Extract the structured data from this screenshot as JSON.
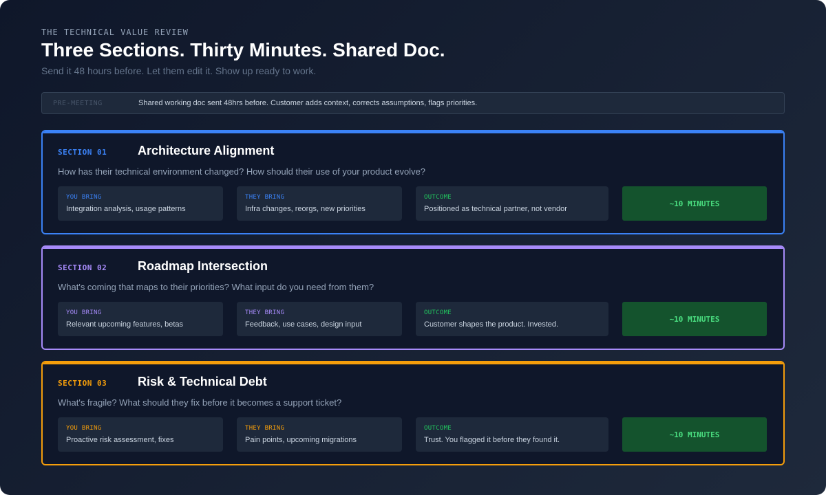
{
  "header": {
    "eyebrow": "THE TECHNICAL VALUE REVIEW",
    "title": "Three Sections. Thirty Minutes. Shared Doc.",
    "subtitle": "Send it 48 hours before. Let them edit it. Show up ready to work."
  },
  "premeeting": {
    "tag": "PRE-MEETING",
    "text": "Shared working doc sent 48hrs before. Customer adds context, corrects assumptions, flags priorities."
  },
  "sections": [
    {
      "label": "SECTION 01",
      "title": "Architecture Alignment",
      "question": "How has their technical environment changed? How should their use of your product evolve?",
      "accent": "#3b82f6",
      "you_bring": {
        "label": "YOU BRING",
        "text": "Integration analysis, usage patterns"
      },
      "they_bring": {
        "label": "THEY BRING",
        "text": "Infra changes, reorgs, new priorities"
      },
      "outcome": {
        "label": "OUTCOME",
        "text": "Positioned as technical partner, not vendor"
      },
      "time": "~10 MINUTES"
    },
    {
      "label": "SECTION 02",
      "title": "Roadmap Intersection",
      "question": "What's coming that maps to their priorities? What input do you need from them?",
      "accent": "#a78bfa",
      "you_bring": {
        "label": "YOU BRING",
        "text": "Relevant upcoming features, betas"
      },
      "they_bring": {
        "label": "THEY BRING",
        "text": "Feedback, use cases, design input"
      },
      "outcome": {
        "label": "OUTCOME",
        "text": "Customer shapes the product. Invested."
      },
      "time": "~10 MINUTES"
    },
    {
      "label": "SECTION 03",
      "title": "Risk & Technical Debt",
      "question": "What's fragile? What should they fix before it becomes a support ticket?",
      "accent": "#f59e0b",
      "you_bring": {
        "label": "YOU BRING",
        "text": "Proactive risk assessment, fixes"
      },
      "they_bring": {
        "label": "THEY BRING",
        "text": "Pain points, upcoming migrations"
      },
      "outcome": {
        "label": "OUTCOME",
        "text": "Trust. You flagged it before they found it."
      },
      "time": "~10 MINUTES"
    }
  ]
}
